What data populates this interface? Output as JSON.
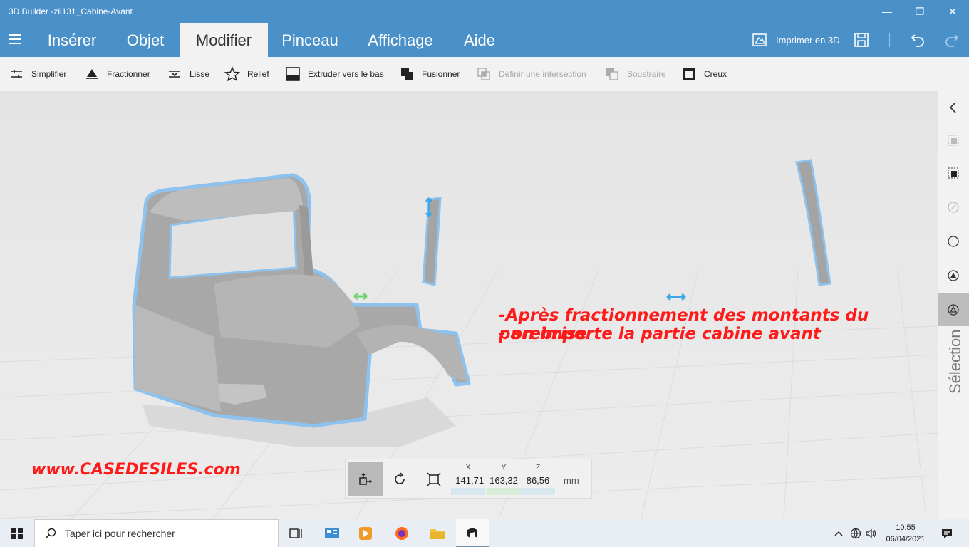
{
  "window": {
    "title": "3D Builder -zil131_Cabine-Avant",
    "controls": {
      "minimize": "—",
      "maximize": "❐",
      "close": "✕"
    }
  },
  "ribbon": {
    "tabs": [
      {
        "label": "Insérer"
      },
      {
        "label": "Objet"
      },
      {
        "label": "Modifier",
        "active": true
      },
      {
        "label": "Pinceau"
      },
      {
        "label": "Affichage"
      },
      {
        "label": "Aide"
      }
    ],
    "print_label": "Imprimer en 3D"
  },
  "toolbar": {
    "tools": [
      {
        "label": "Simplifier",
        "enabled": true
      },
      {
        "label": "Fractionner",
        "enabled": true
      },
      {
        "label": "Lisse",
        "enabled": true
      },
      {
        "label": "Relief",
        "enabled": true
      },
      {
        "label": "Extruder vers le bas",
        "enabled": true
      },
      {
        "label": "Fusionner",
        "enabled": true
      },
      {
        "label": "Définir une intersection",
        "enabled": false
      },
      {
        "label": "Soustraire",
        "enabled": false
      },
      {
        "label": "Creux",
        "enabled": true
      }
    ]
  },
  "right_panel": {
    "label": "Sélection"
  },
  "annotations": {
    "line1": "-Après fractionnement des montants du parebrise",
    "line2": "- on importe la partie cabine avant",
    "website": "www.CASEDESILES.com"
  },
  "transform": {
    "x": {
      "label": "X",
      "value": "-141,71"
    },
    "y": {
      "label": "Y",
      "value": "163,32"
    },
    "z": {
      "label": "Z",
      "value": "86,56"
    },
    "unit": "mm"
  },
  "taskbar": {
    "search_placeholder": "Taper ici pour rechercher",
    "time": "10:55",
    "date": "06/04/2021"
  },
  "colors": {
    "accent": "#4a90c9",
    "annotation": "#ff1a1a",
    "selection_outline": "#8ec2ee"
  }
}
